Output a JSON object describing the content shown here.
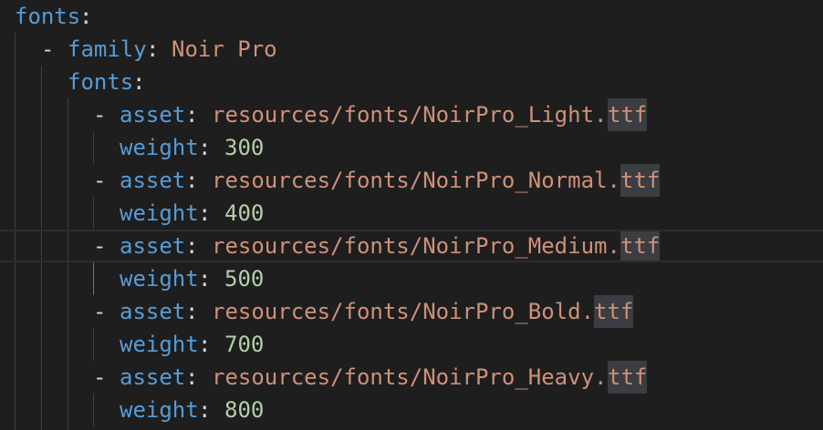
{
  "yaml": {
    "root_key": "fonts",
    "family_key": "family",
    "family_value": "Noir Pro",
    "nested_key": "fonts",
    "asset_key": "asset",
    "weight_key": "weight",
    "ext": "ttf",
    "items": [
      {
        "path": "resources/fonts/NoirPro_Light.",
        "weight": "300"
      },
      {
        "path": "resources/fonts/NoirPro_Normal.",
        "weight": "400"
      },
      {
        "path": "resources/fonts/NoirPro_Medium.",
        "weight": "500"
      },
      {
        "path": "resources/fonts/NoirPro_Bold.",
        "weight": "700"
      },
      {
        "path": "resources/fonts/NoirPro_Heavy.",
        "weight": "800"
      }
    ]
  },
  "punctuation": {
    "colon": ":",
    "dash": "-"
  },
  "colors": {
    "background": "#1e1e1e",
    "key": "#569cd6",
    "string": "#ce9178",
    "number": "#b5cea8",
    "highlight": "#3a3d41"
  }
}
